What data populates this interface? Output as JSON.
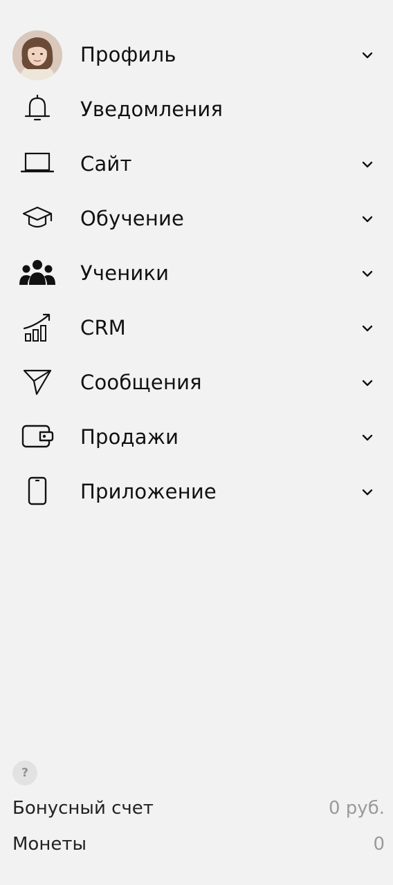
{
  "menu": {
    "items": [
      {
        "label": "Профиль",
        "icon": "avatar",
        "has_chevron": true
      },
      {
        "label": "Уведомления",
        "icon": "bell-icon",
        "has_chevron": false
      },
      {
        "label": "Сайт",
        "icon": "laptop-icon",
        "has_chevron": true
      },
      {
        "label": "Обучение",
        "icon": "graduation-cap-icon",
        "has_chevron": true
      },
      {
        "label": "Ученики",
        "icon": "users-icon",
        "has_chevron": true
      },
      {
        "label": "CRM",
        "icon": "chart-growth-icon",
        "has_chevron": true
      },
      {
        "label": "Сообщения",
        "icon": "send-icon",
        "has_chevron": true
      },
      {
        "label": "Продажи",
        "icon": "wallet-icon",
        "has_chevron": true
      },
      {
        "label": "Приложение",
        "icon": "smartphone-icon",
        "has_chevron": true
      }
    ]
  },
  "footer": {
    "help_label": "?",
    "bonus_label": "Бонусный счет",
    "bonus_value": "0 руб.",
    "coins_label": "Монеты",
    "coins_value": "0"
  },
  "colors": {
    "background": "#f2f2f2",
    "text": "#111111",
    "muted": "#9a9a9a",
    "help_bg": "#e2e2e2"
  }
}
